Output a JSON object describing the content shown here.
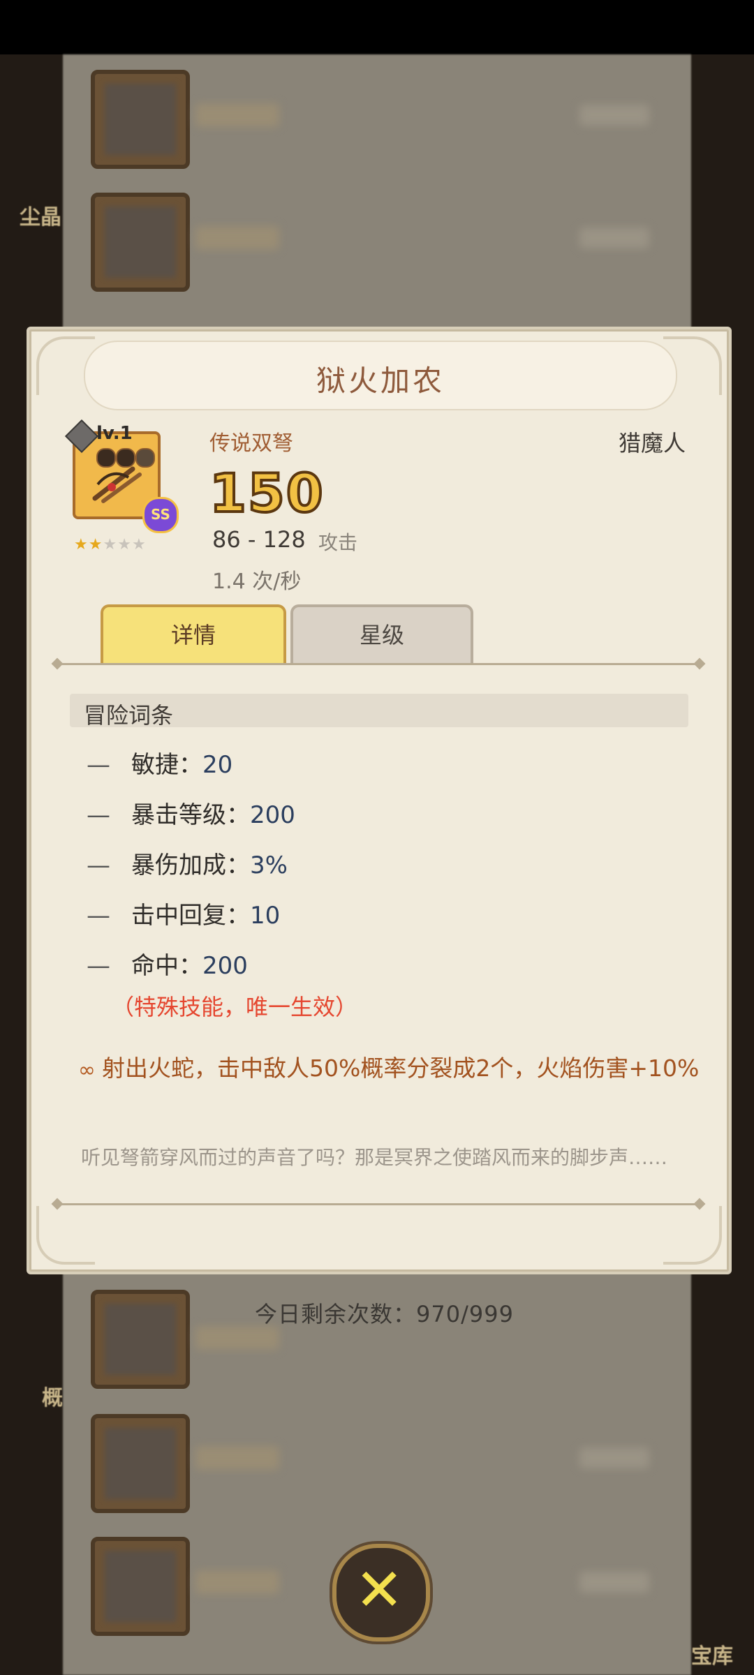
{
  "background": {
    "side_left_label_top": "尘晶",
    "side_left_label_bottom": "概",
    "side_right_label_bottom": "宝库",
    "remaining_today": "今日剩余次数：970/999"
  },
  "modal": {
    "title": "狱火加农",
    "weapon": {
      "level": "lv.1",
      "type": "传说双弩",
      "class": "猎魔人",
      "power": "150",
      "attack_range": "86 - 128",
      "attack_label": "攻击",
      "speed": "1.4 次/秒",
      "grade_badge": "SS",
      "stars_filled": 2,
      "stars_total": 5
    },
    "tabs": [
      {
        "label": "详情",
        "active": true
      },
      {
        "label": "星级",
        "active": false
      }
    ],
    "section_title": "冒险词条",
    "attributes": [
      {
        "name": "敏捷：",
        "value": "20"
      },
      {
        "name": "暴击等级：",
        "value": "200"
      },
      {
        "name": "暴伤加成：",
        "value": "3%"
      },
      {
        "name": "击中回复：",
        "value": "10"
      },
      {
        "name": "命中：",
        "value": "200"
      }
    ],
    "special_note": "（特殊技能，唯一生效）",
    "skill_icon": "link-icon",
    "skill_text": "射出火蛇，击中敌人50%概率分裂成2个，火焰伤害+10%",
    "flavor_text": "听见弩箭穿风而过的声音了吗？那是冥界之使踏风而来的脚步声……"
  },
  "close_icon": "close-x-icon",
  "colors": {
    "title": "#8e5a3c",
    "power_fill": "#f2c144",
    "special_note": "#e5462f",
    "skill_text": "#a2521f",
    "active_tab": "#f6e17a"
  }
}
